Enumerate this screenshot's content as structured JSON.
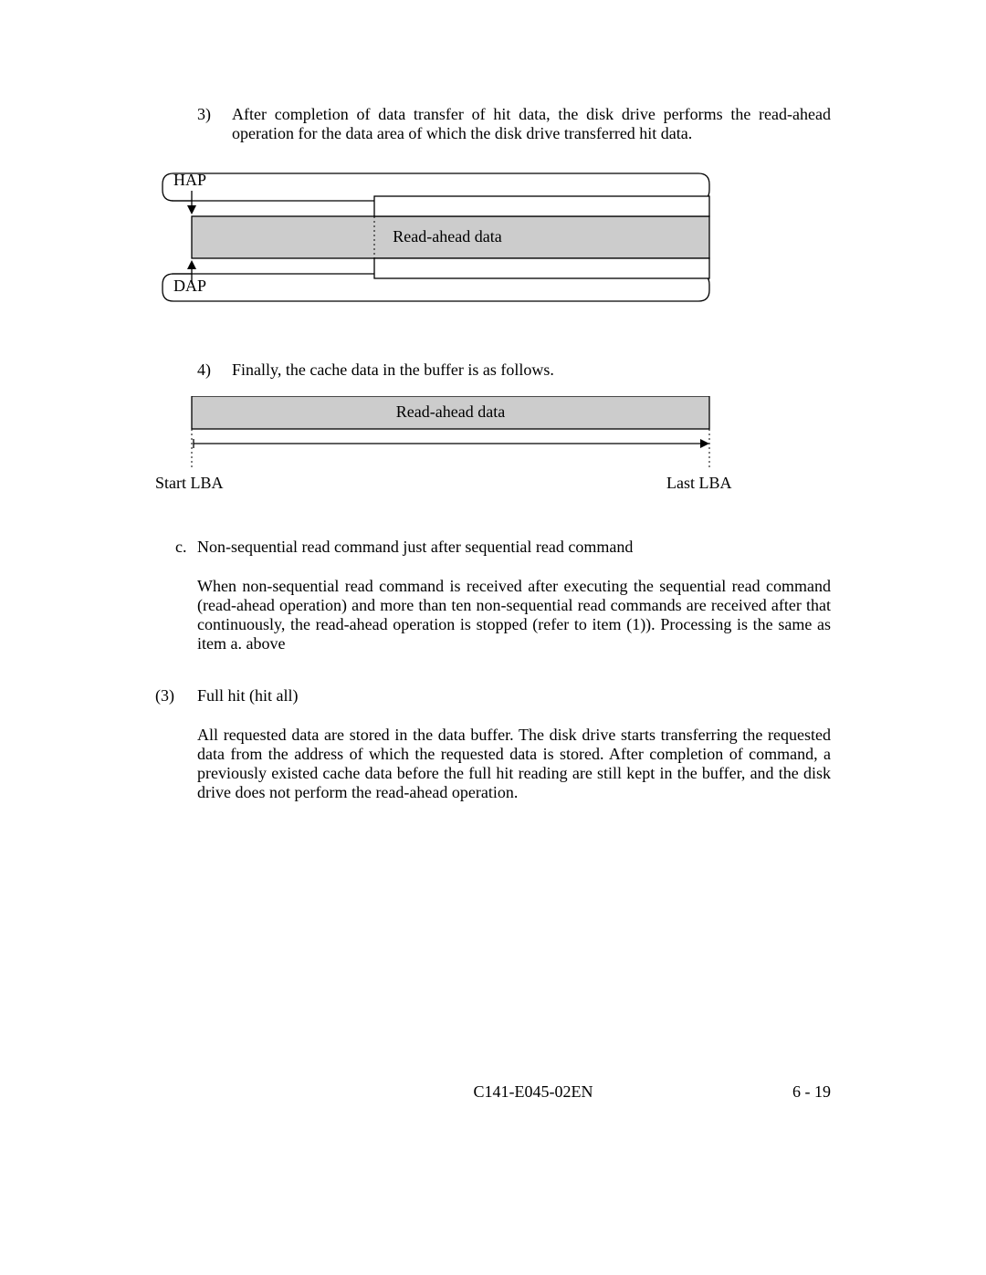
{
  "item3": {
    "num": "3)",
    "text": "After completion of data transfer of hit data, the disk drive performs the read-ahead operation for the data area of which the disk drive transferred hit data."
  },
  "diagram1": {
    "hap": "HAP",
    "dap": "DAP",
    "readAhead": "Read-ahead data"
  },
  "item4": {
    "num": "4)",
    "text": "Finally, the cache data in the buffer is as follows."
  },
  "diagram2": {
    "readAhead": "Read-ahead data",
    "startLBA": "Start LBA",
    "lastLBA": "Last LBA"
  },
  "letterC": {
    "letter": "c.",
    "title": "Non-sequential read command just after sequential read command",
    "para": "When non-sequential read command is received after executing the sequential read command (read-ahead operation) and more than ten non-sequential read commands are received after that continuously, the read-ahead operation is stopped (refer to item (1)). Processing is the same as item a. above"
  },
  "section3": {
    "num": "(3)",
    "title": "Full hit (hit all)",
    "para": "All requested data are stored in the data buffer.  The disk drive starts transferring the requested data from the address of which the requested data is stored.  After completion of command, a previously existed cache data before the full hit reading are still kept in the buffer, and the disk drive does not perform the read-ahead operation."
  },
  "footer": {
    "docid": "C141-E045-02EN",
    "pagenum": "6 - 19"
  }
}
